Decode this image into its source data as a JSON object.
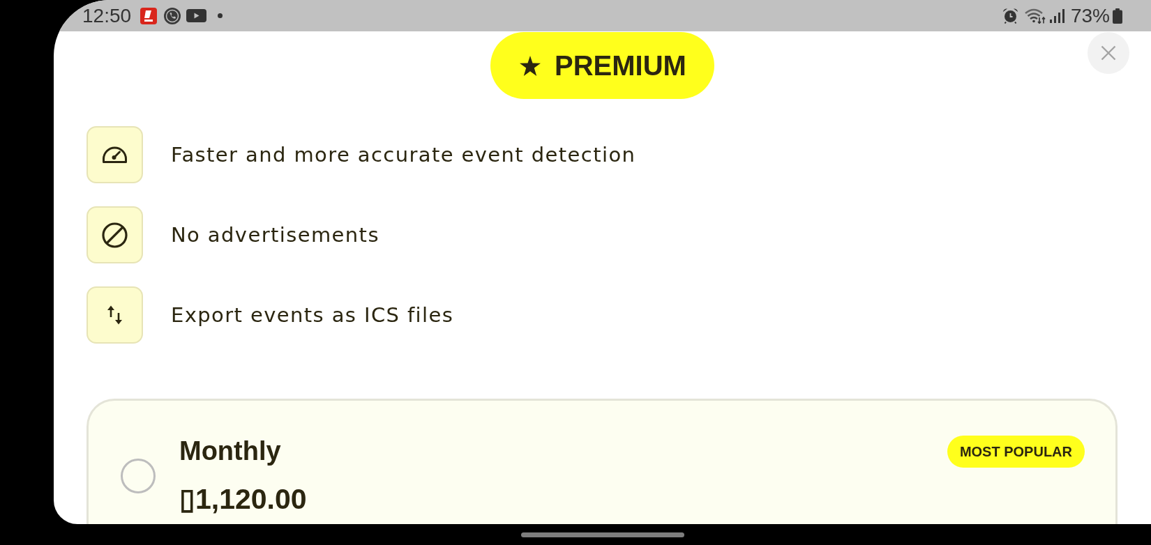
{
  "status_bar": {
    "time": "12:50",
    "battery": "73%"
  },
  "header": {
    "title": "PREMIUM"
  },
  "features": [
    {
      "text": "Faster and more accurate event detection"
    },
    {
      "text": "No advertisements"
    },
    {
      "text": "Export events as ICS files"
    }
  ],
  "plans": [
    {
      "name": "Monthly",
      "price": "▯1,120.00",
      "badge": "MOST POPULAR",
      "selected": false
    }
  ]
}
